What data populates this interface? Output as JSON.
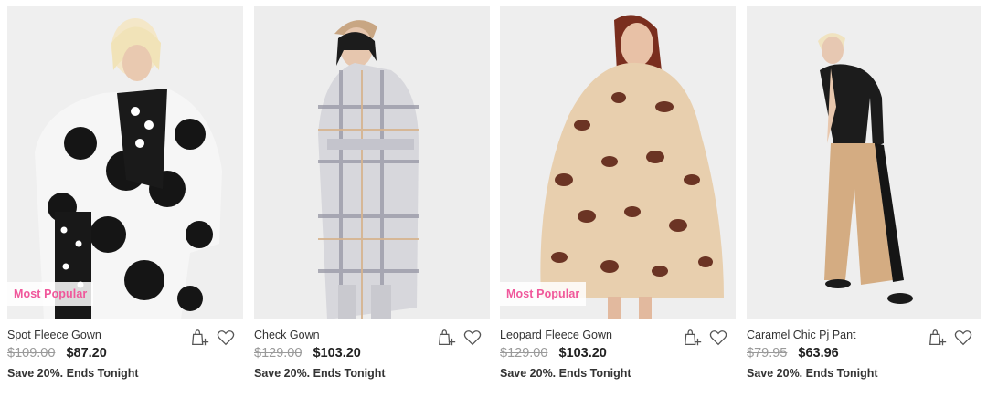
{
  "products": [
    {
      "name": "Spot Fleece Gown",
      "was_price": "$109.00",
      "now_price": "$87.20",
      "promo": "Save 20%. Ends Tonight",
      "badge": "Most Popular",
      "image_icon": "model-photo-spot-gown"
    },
    {
      "name": "Check Gown",
      "was_price": "$129.00",
      "now_price": "$103.20",
      "promo": "Save 20%. Ends Tonight",
      "badge": "",
      "image_icon": "model-photo-check-gown"
    },
    {
      "name": "Leopard Fleece Gown",
      "was_price": "$129.00",
      "now_price": "$103.20",
      "promo": "Save 20%. Ends Tonight",
      "badge": "Most Popular",
      "image_icon": "model-photo-leopard-gown"
    },
    {
      "name": "Caramel Chic Pj Pant",
      "was_price": "$79.95",
      "now_price": "$63.96",
      "promo": "Save 20%. Ends Tonight",
      "badge": "",
      "image_icon": "model-photo-caramel-pant"
    }
  ],
  "colors": {
    "badge_text": "#f0579b",
    "was_price": "#9a9a9a",
    "photo_bg": "#ececec"
  }
}
